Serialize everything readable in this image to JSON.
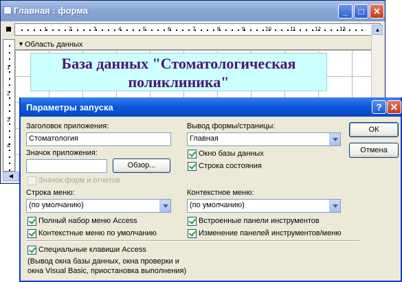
{
  "back_window": {
    "title": "Главная : форма",
    "min_glyph": "_",
    "max_glyph": "□",
    "close_glyph": "✕",
    "ruler_h": [
      "1",
      "2",
      "3",
      "4",
      "5",
      "6",
      "7",
      "8",
      "9",
      "10",
      "11",
      "12",
      "13"
    ],
    "ruler_v": [
      "1",
      "2",
      "3",
      "4"
    ],
    "section_label": "Область данных",
    "title_label": "База данных \"Стоматологическая поликлиника\""
  },
  "dialog": {
    "title": "Параметры запуска",
    "help_glyph": "?",
    "close_glyph": "✕",
    "app_title_label": "Заголовок приложения:",
    "app_title_value": "Стоматология",
    "app_icon_label": "Значок приложения:",
    "app_icon_value": "",
    "browse_button": "Обзор...",
    "forms_icon_label": "Значок форм и отчетов",
    "forms_icon_checked": false,
    "form_page_label": "Вывод формы/страницы:",
    "form_page_value": "Главная",
    "db_window_label": "Окно базы данных",
    "db_window_checked": true,
    "status_bar_label": "Строка состояния",
    "status_bar_checked": true,
    "menu_bar_label": "Строка меню:",
    "menu_bar_value": "(по умолчанию)",
    "context_menu_label": "Контекстное меню:",
    "context_menu_value": "(по умолчанию)",
    "full_menus_label": "Полный набор меню Access",
    "full_menus_checked": true,
    "default_context_label": "Контекстные меню по умолчанию",
    "default_context_checked": true,
    "builtin_toolbars_label": "Встроенные панели инструментов",
    "builtin_toolbars_checked": true,
    "toolbar_changes_label": "Изменение панелей инструментов/меню",
    "toolbar_changes_checked": true,
    "special_keys_label": "Специальные клавиши Access",
    "special_keys_checked": true,
    "special_keys_note_line1": "(Вывод окна базы данных, окна проверки и",
    "special_keys_note_line2": "окна Visual Basic, приостановка выполнения)",
    "ok_button": "ОК",
    "cancel_button": "Отмена"
  },
  "colors": {
    "title_text": "#4b1575",
    "title_box_bg": "#ccffff",
    "dialog_titlebar": "#0a5ad8",
    "back_titlebar": "#8aa6d6"
  }
}
